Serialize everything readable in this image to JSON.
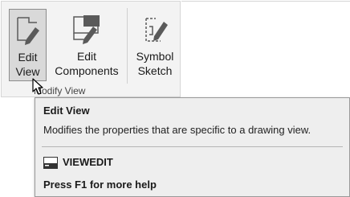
{
  "ribbon": {
    "panel_title": "Modify View",
    "buttons": [
      {
        "line1": "Edit",
        "line2": "View",
        "icon": "edit-view-icon"
      },
      {
        "line1": "Edit",
        "line2": "Components",
        "icon": "edit-components-icon"
      },
      {
        "line1": "Symbol",
        "line2": "Sketch",
        "icon": "symbol-sketch-icon"
      }
    ]
  },
  "tooltip": {
    "title": "Edit View",
    "description": "Modifies the properties that are specific to a drawing view.",
    "command": "VIEWEDIT",
    "command_icon": "command-line-icon",
    "help": "Press F1 for more help"
  },
  "colors": {
    "ribbon_bg": "#f3f3f3",
    "active_button_bg": "#d9d9d9",
    "tooltip_bg": "#eeeeee",
    "icon_dark": "#4a4a4a"
  }
}
